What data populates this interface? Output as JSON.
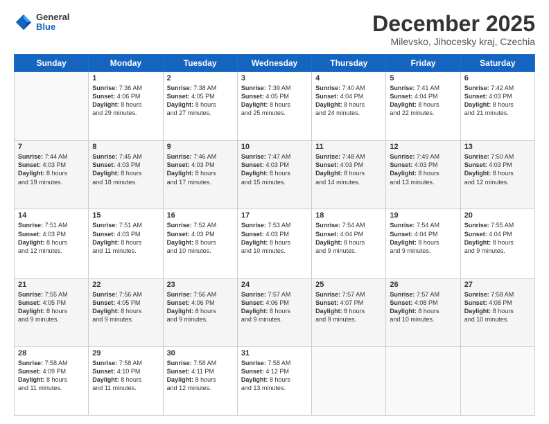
{
  "header": {
    "logo_general": "General",
    "logo_blue": "Blue",
    "month_title": "December 2025",
    "location": "Milevsko, Jihocesky kraj, Czechia"
  },
  "days_of_week": [
    "Sunday",
    "Monday",
    "Tuesday",
    "Wednesday",
    "Thursday",
    "Friday",
    "Saturday"
  ],
  "weeks": [
    [
      {
        "day": "",
        "info": ""
      },
      {
        "day": "1",
        "info": "Sunrise: 7:36 AM\nSunset: 4:06 PM\nDaylight: 8 hours\nand 29 minutes."
      },
      {
        "day": "2",
        "info": "Sunrise: 7:38 AM\nSunset: 4:05 PM\nDaylight: 8 hours\nand 27 minutes."
      },
      {
        "day": "3",
        "info": "Sunrise: 7:39 AM\nSunset: 4:05 PM\nDaylight: 8 hours\nand 25 minutes."
      },
      {
        "day": "4",
        "info": "Sunrise: 7:40 AM\nSunset: 4:04 PM\nDaylight: 8 hours\nand 24 minutes."
      },
      {
        "day": "5",
        "info": "Sunrise: 7:41 AM\nSunset: 4:04 PM\nDaylight: 8 hours\nand 22 minutes."
      },
      {
        "day": "6",
        "info": "Sunrise: 7:42 AM\nSunset: 4:03 PM\nDaylight: 8 hours\nand 21 minutes."
      }
    ],
    [
      {
        "day": "7",
        "info": "Sunrise: 7:44 AM\nSunset: 4:03 PM\nDaylight: 8 hours\nand 19 minutes."
      },
      {
        "day": "8",
        "info": "Sunrise: 7:45 AM\nSunset: 4:03 PM\nDaylight: 8 hours\nand 18 minutes."
      },
      {
        "day": "9",
        "info": "Sunrise: 7:46 AM\nSunset: 4:03 PM\nDaylight: 8 hours\nand 17 minutes."
      },
      {
        "day": "10",
        "info": "Sunrise: 7:47 AM\nSunset: 4:03 PM\nDaylight: 8 hours\nand 15 minutes."
      },
      {
        "day": "11",
        "info": "Sunrise: 7:48 AM\nSunset: 4:03 PM\nDaylight: 8 hours\nand 14 minutes."
      },
      {
        "day": "12",
        "info": "Sunrise: 7:49 AM\nSunset: 4:03 PM\nDaylight: 8 hours\nand 13 minutes."
      },
      {
        "day": "13",
        "info": "Sunrise: 7:50 AM\nSunset: 4:03 PM\nDaylight: 8 hours\nand 12 minutes."
      }
    ],
    [
      {
        "day": "14",
        "info": "Sunrise: 7:51 AM\nSunset: 4:03 PM\nDaylight: 8 hours\nand 12 minutes."
      },
      {
        "day": "15",
        "info": "Sunrise: 7:51 AM\nSunset: 4:03 PM\nDaylight: 8 hours\nand 11 minutes."
      },
      {
        "day": "16",
        "info": "Sunrise: 7:52 AM\nSunset: 4:03 PM\nDaylight: 8 hours\nand 10 minutes."
      },
      {
        "day": "17",
        "info": "Sunrise: 7:53 AM\nSunset: 4:03 PM\nDaylight: 8 hours\nand 10 minutes."
      },
      {
        "day": "18",
        "info": "Sunrise: 7:54 AM\nSunset: 4:04 PM\nDaylight: 8 hours\nand 9 minutes."
      },
      {
        "day": "19",
        "info": "Sunrise: 7:54 AM\nSunset: 4:04 PM\nDaylight: 8 hours\nand 9 minutes."
      },
      {
        "day": "20",
        "info": "Sunrise: 7:55 AM\nSunset: 4:04 PM\nDaylight: 8 hours\nand 9 minutes."
      }
    ],
    [
      {
        "day": "21",
        "info": "Sunrise: 7:55 AM\nSunset: 4:05 PM\nDaylight: 8 hours\nand 9 minutes."
      },
      {
        "day": "22",
        "info": "Sunrise: 7:56 AM\nSunset: 4:05 PM\nDaylight: 8 hours\nand 9 minutes."
      },
      {
        "day": "23",
        "info": "Sunrise: 7:56 AM\nSunset: 4:06 PM\nDaylight: 8 hours\nand 9 minutes."
      },
      {
        "day": "24",
        "info": "Sunrise: 7:57 AM\nSunset: 4:06 PM\nDaylight: 8 hours\nand 9 minutes."
      },
      {
        "day": "25",
        "info": "Sunrise: 7:57 AM\nSunset: 4:07 PM\nDaylight: 8 hours\nand 9 minutes."
      },
      {
        "day": "26",
        "info": "Sunrise: 7:57 AM\nSunset: 4:08 PM\nDaylight: 8 hours\nand 10 minutes."
      },
      {
        "day": "27",
        "info": "Sunrise: 7:58 AM\nSunset: 4:08 PM\nDaylight: 8 hours\nand 10 minutes."
      }
    ],
    [
      {
        "day": "28",
        "info": "Sunrise: 7:58 AM\nSunset: 4:09 PM\nDaylight: 8 hours\nand 11 minutes."
      },
      {
        "day": "29",
        "info": "Sunrise: 7:58 AM\nSunset: 4:10 PM\nDaylight: 8 hours\nand 11 minutes."
      },
      {
        "day": "30",
        "info": "Sunrise: 7:58 AM\nSunset: 4:11 PM\nDaylight: 8 hours\nand 12 minutes."
      },
      {
        "day": "31",
        "info": "Sunrise: 7:58 AM\nSunset: 4:12 PM\nDaylight: 8 hours\nand 13 minutes."
      },
      {
        "day": "",
        "info": ""
      },
      {
        "day": "",
        "info": ""
      },
      {
        "day": "",
        "info": ""
      }
    ]
  ]
}
